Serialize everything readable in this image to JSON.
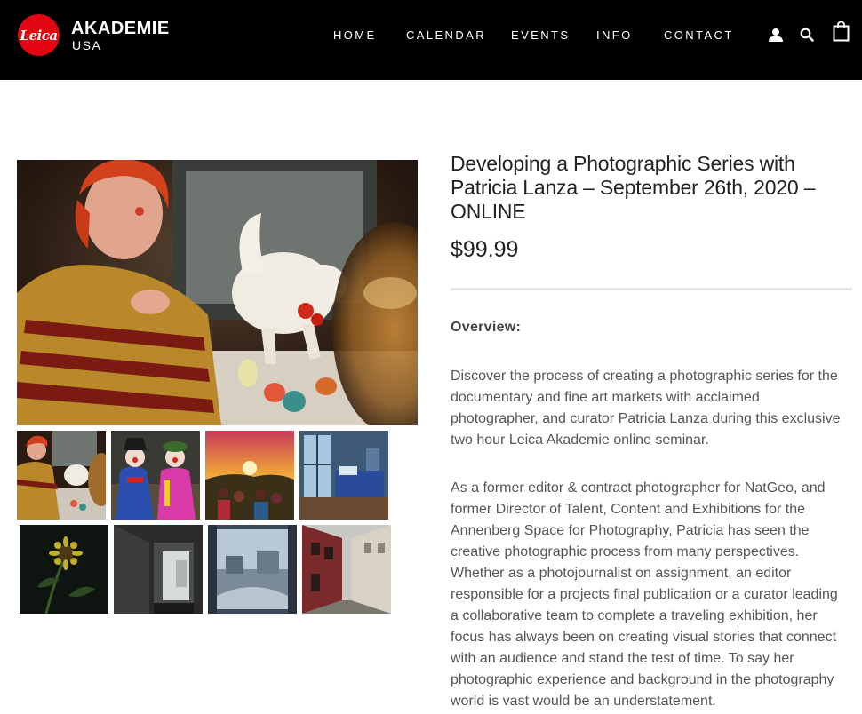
{
  "brand": {
    "logo_text": "Leica",
    "title": "AKADEMIE",
    "subtitle": "USA",
    "accent_color": "#e20612"
  },
  "nav": {
    "items": [
      {
        "label": "HOME"
      },
      {
        "label": "CALENDAR"
      },
      {
        "label": "EVENTS"
      },
      {
        "label": "INFO"
      },
      {
        "label": "CONTACT"
      }
    ],
    "icons": [
      "user-icon",
      "search-icon",
      "shopping-bag-icon"
    ]
  },
  "gallery": {
    "main_image": "photo-clown-woman-with-white-cat",
    "thumbnails": [
      "thumb-clown-woman-with-cat",
      "thumb-two-clowns",
      "thumb-sunset-crowd",
      "thumb-bedroom-window",
      "thumb-sunflower-night",
      "thumb-dark-hallway",
      "thumb-window-rooftops",
      "thumb-red-street"
    ]
  },
  "product": {
    "title": "Developing a Photographic Series with Patricia Lanza – September 26th, 2020 – ONLINE",
    "price": "$99.99",
    "overview_label": "Overview:",
    "paragraphs": [
      "Discover the process of creating a photographic series for the documentary and fine art markets with acclaimed photographer, and curator Patricia Lanza during this exclusive two hour Leica Akademie online seminar.",
      "As a former editor & contract photographer for NatGeo, and former Director of Talent, Content and Exhibitions for the Annenberg Space for Photography, Patricia has seen the creative photographic process from many perspectives. Whether as a photojournalist on assignment, an editor responsible for a projects final publication or a curator leading a collaborative team to complete a traveling exhibition, her focus has always been on creating visual stories that connect with an audience and stand the test of time. To say her photographic experience and background in the photography world is vast would be an understatement."
    ]
  }
}
